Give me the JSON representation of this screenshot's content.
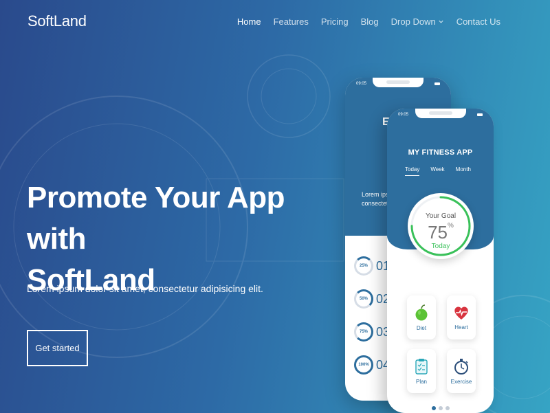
{
  "brand": {
    "logo_text": "SoftLand"
  },
  "nav": {
    "items": [
      {
        "label": "Home",
        "active": true
      },
      {
        "label": "Features"
      },
      {
        "label": "Pricing"
      },
      {
        "label": "Blog"
      },
      {
        "label": "Drop Down",
        "has_dropdown": true
      },
      {
        "label": "Contact Us"
      }
    ]
  },
  "hero": {
    "title_line1": "Promote Your App with",
    "title_line2": "SoftLand",
    "subtitle": "Lorem ipsum dolor sit amet, consectetur adipisicing elit.",
    "cta_label": "Get started"
  },
  "phone_back": {
    "status_time": "09:05",
    "header_text": "EX",
    "body_text": "Lorem ipsu consectetur",
    "rows": [
      {
        "pct": "25%",
        "number": "01"
      },
      {
        "pct": "50%",
        "number": "02"
      },
      {
        "pct": "75%",
        "number": "03"
      },
      {
        "pct": "100%",
        "number": "04"
      }
    ]
  },
  "phone_front": {
    "status_time": "09:05",
    "app_title": "MY FITNESS APP",
    "tabs": [
      "Today",
      "Week",
      "Month"
    ],
    "goal": {
      "title": "Your Goal",
      "value": "75",
      "unit": "%",
      "period": "Today",
      "progress": 0.75
    },
    "tiles": [
      {
        "label": "Diet",
        "icon": "apple-icon"
      },
      {
        "label": "Heart",
        "icon": "heart-icon"
      },
      {
        "label": "Plan",
        "icon": "clipboard-icon"
      },
      {
        "label": "Exercise",
        "icon": "stopwatch-icon"
      }
    ],
    "carousel": {
      "count": 3,
      "active_index": 0
    }
  },
  "colors": {
    "accent_blue": "#2d6e9e",
    "goal_green": "#3ac15a",
    "heart_red": "#d8343f"
  }
}
